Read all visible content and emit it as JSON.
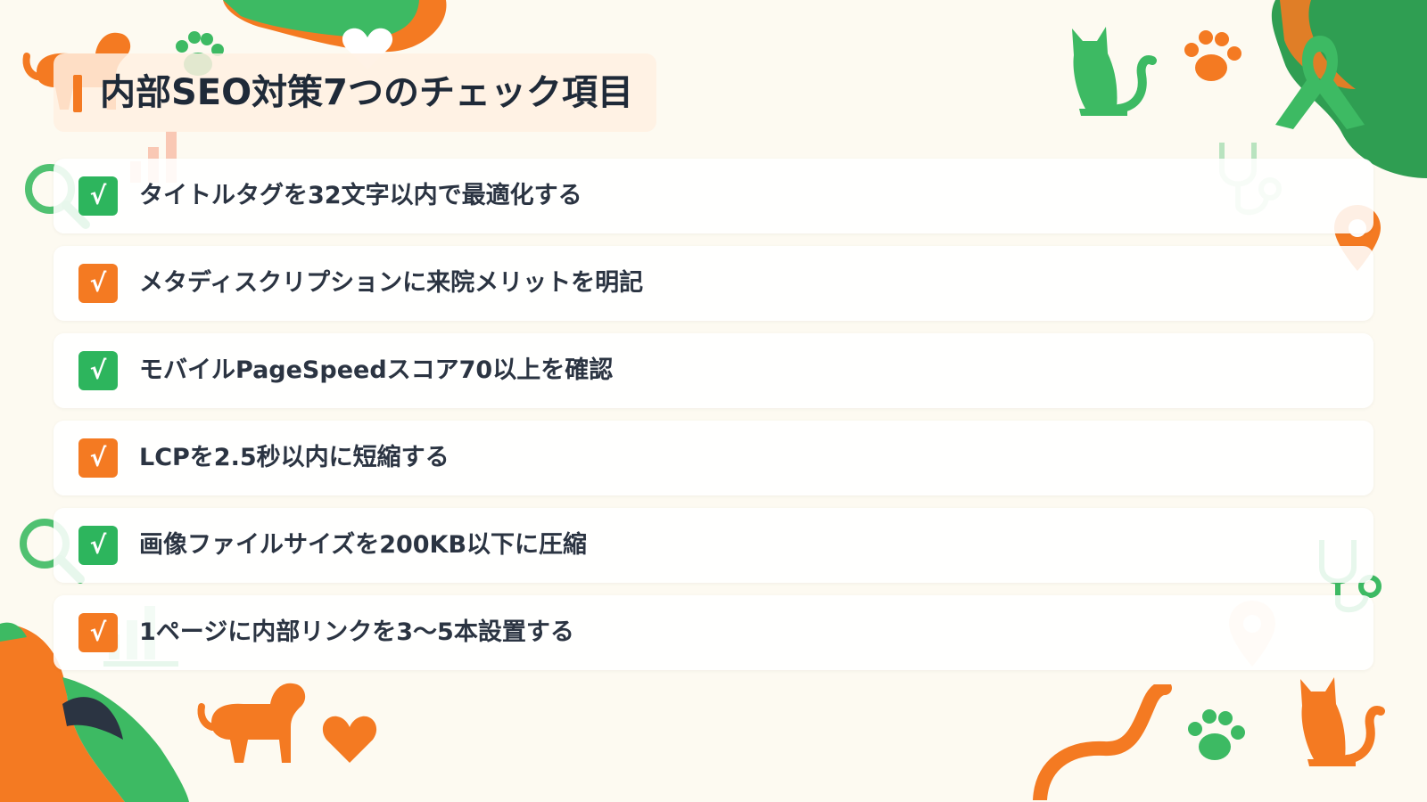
{
  "title": "内部SEO対策7つのチェック項目",
  "check_symbol": "√",
  "colors": {
    "green": "#2db55d",
    "orange": "#f47a22",
    "dark": "#2b3442",
    "background": "#fdfaf1"
  },
  "items": [
    {
      "label": "タイトルタグを32文字以内で最適化する",
      "color": "green",
      "checked": true
    },
    {
      "label": "メタディスクリプションに来院メリットを明記",
      "color": "orange",
      "checked": true
    },
    {
      "label": "モバイルPageSpeedスコア70以上を確認",
      "color": "green",
      "checked": true
    },
    {
      "label": "LCPを2.5秒以内に短縮する",
      "color": "orange",
      "checked": true
    },
    {
      "label": "画像ファイルサイズを200KB以下に圧縮",
      "color": "green",
      "checked": true
    },
    {
      "label": "1ページに内部リンクを3〜5本設置する",
      "color": "orange",
      "checked": true
    }
  ],
  "decorations": [
    "dog-icon",
    "paw-icon",
    "heart-icon",
    "cat-icon",
    "ribbon-icon",
    "stethoscope-icon",
    "map-pin-icon",
    "magnifier-icon",
    "bar-chart-icon"
  ]
}
